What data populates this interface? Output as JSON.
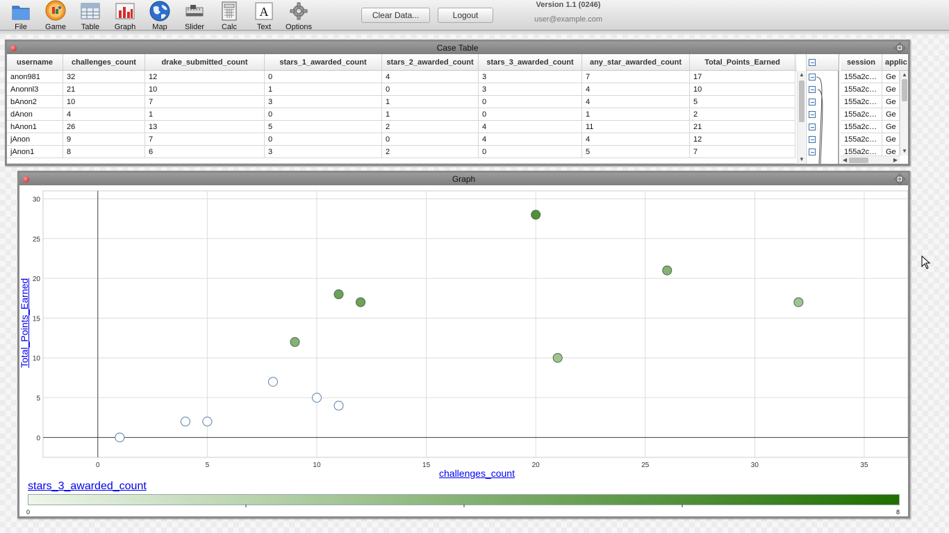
{
  "toolbar": {
    "tools": [
      {
        "label": "File",
        "icon": "folder-icon"
      },
      {
        "label": "Game",
        "icon": "game-icon"
      },
      {
        "label": "Table",
        "icon": "table-icon"
      },
      {
        "label": "Graph",
        "icon": "graph-icon"
      },
      {
        "label": "Map",
        "icon": "globe-icon"
      },
      {
        "label": "Slider",
        "icon": "slider-icon"
      },
      {
        "label": "Calc",
        "icon": "calculator-icon"
      },
      {
        "label": "Text",
        "icon": "text-icon"
      },
      {
        "label": "Options",
        "icon": "gear-icon"
      }
    ],
    "clear_label": "Clear Data...",
    "logout_label": "Logout",
    "version": "Version 1.1 (0246)",
    "user": "user@example.com"
  },
  "case_table": {
    "title": "Case Table",
    "columns": [
      "username",
      "challenges_count",
      "drake_submitted_count",
      "stars_1_awarded_count",
      "stars_2_awarded_count",
      "stars_3_awarded_count",
      "any_star_awarded_count",
      "Total_Points_Earned"
    ],
    "rows": [
      [
        "anon981",
        "32",
        "12",
        "0",
        "4",
        "3",
        "7",
        "17"
      ],
      [
        "Anonnl3",
        "21",
        "10",
        "1",
        "0",
        "3",
        "4",
        "10"
      ],
      [
        "bAnon2",
        "10",
        "7",
        "3",
        "1",
        "0",
        "4",
        "5"
      ],
      [
        "dAnon",
        "4",
        "1",
        "0",
        "1",
        "0",
        "1",
        "2"
      ],
      [
        "hAnon1",
        "26",
        "13",
        "5",
        "2",
        "4",
        "11",
        "21"
      ],
      [
        "jAnon",
        "9",
        "7",
        "0",
        "0",
        "4",
        "4",
        "12"
      ],
      [
        "jAnon1",
        "8",
        "6",
        "3",
        "2",
        "0",
        "5",
        "7"
      ]
    ],
    "child_columns": [
      "session",
      "applic"
    ],
    "child_rows": [
      [
        "155a2c…",
        "Ge"
      ],
      [
        "155a2c…",
        "Ge"
      ],
      [
        "155a2c…",
        "Ge"
      ],
      [
        "155a2c…",
        "Ge"
      ],
      [
        "155a2c…",
        "Ge"
      ],
      [
        "155a2c…",
        "Ge"
      ],
      [
        "155a2c…",
        "Ge"
      ]
    ]
  },
  "graph": {
    "title": "Graph",
    "legend_attr": "stars_3_awarded_count",
    "legend_min": "0",
    "legend_max": "8",
    "colors": {
      "low": "#eef6ea",
      "high": "#1e6e00",
      "stroke": "#5a7fa8"
    }
  },
  "chart_data": {
    "type": "scatter",
    "xlabel": "challenges_count",
    "ylabel": "Total_Points_Earned",
    "xlim": [
      -2.5,
      37
    ],
    "ylim": [
      -2.5,
      31
    ],
    "xticks": [
      0,
      5,
      10,
      15,
      20,
      25,
      30,
      35
    ],
    "yticks": [
      0,
      5,
      10,
      15,
      20,
      25,
      30
    ],
    "grid": true,
    "points": [
      {
        "x": 1,
        "y": 0,
        "c": 0
      },
      {
        "x": 4,
        "y": 2,
        "c": 0
      },
      {
        "x": 5,
        "y": 2,
        "c": 0
      },
      {
        "x": 8,
        "y": 7,
        "c": 0
      },
      {
        "x": 10,
        "y": 5,
        "c": 0
      },
      {
        "x": 11,
        "y": 4,
        "c": 0
      },
      {
        "x": 9,
        "y": 12,
        "c": 4
      },
      {
        "x": 11,
        "y": 18,
        "c": 5
      },
      {
        "x": 12,
        "y": 17,
        "c": 5
      },
      {
        "x": 20,
        "y": 28,
        "c": 6
      },
      {
        "x": 21,
        "y": 10,
        "c": 3
      },
      {
        "x": 26,
        "y": 21,
        "c": 4
      },
      {
        "x": 32,
        "y": 17,
        "c": 3
      }
    ],
    "color_range": [
      0,
      8
    ]
  }
}
